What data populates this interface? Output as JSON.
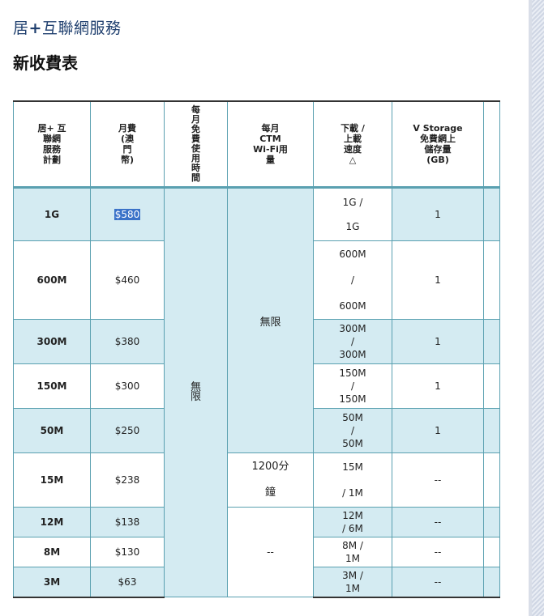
{
  "page": {
    "title_main": "居",
    "title_plus": "+",
    "title_rest": "互聯網服務",
    "subtitle": "新收費表"
  },
  "table": {
    "headers": {
      "plan": [
        "居+ 互",
        "聯網",
        "服務",
        "計劃"
      ],
      "monthly_fee": [
        "月費",
        "(澳",
        "門",
        "幣)"
      ],
      "free_time": [
        "每",
        "月",
        "免",
        "費",
        "使",
        "用",
        "時",
        "間"
      ],
      "wifi": [
        "每月",
        "CTM",
        "Wi-Fi用",
        "量"
      ],
      "speed": [
        "下載 /",
        "上載",
        "速度",
        "△"
      ],
      "storage": [
        "V Storage",
        "免費網上",
        "儲存量",
        "(GB)"
      ]
    },
    "free_time_value": [
      "無",
      "限"
    ],
    "wifi_unlimited": "無限",
    "wifi_15m": [
      "1200分",
      "鐘"
    ],
    "wifi_low": "--",
    "rows": [
      {
        "plan": "1G",
        "fee": "$580",
        "speed": [
          "1G /",
          "1G"
        ],
        "storage": "1"
      },
      {
        "plan": "600M",
        "fee": "$460",
        "speed": [
          "600M",
          "/",
          "600M"
        ],
        "storage": "1"
      },
      {
        "plan": "300M",
        "fee": "$380",
        "speed": [
          "300M",
          "/",
          "300M"
        ],
        "storage": "1"
      },
      {
        "plan": "150M",
        "fee": "$300",
        "speed": [
          "150M",
          "/",
          "150M"
        ],
        "storage": "1"
      },
      {
        "plan": "50M",
        "fee": "$250",
        "speed": [
          "50M",
          "/",
          "50M"
        ],
        "storage": "1"
      },
      {
        "plan": "15M",
        "fee": "$238",
        "speed": [
          "15M",
          "/ 1M"
        ],
        "storage": "--"
      },
      {
        "plan": "12M",
        "fee": "$138",
        "speed": [
          "12M",
          "/ 6M"
        ],
        "storage": "--"
      },
      {
        "plan": "8M",
        "fee": "$130",
        "speed": [
          "8M /",
          "1M"
        ],
        "storage": "--"
      },
      {
        "plan": "3M",
        "fee": "$63",
        "speed": [
          "3M /",
          "1M"
        ],
        "storage": "--"
      }
    ]
  }
}
